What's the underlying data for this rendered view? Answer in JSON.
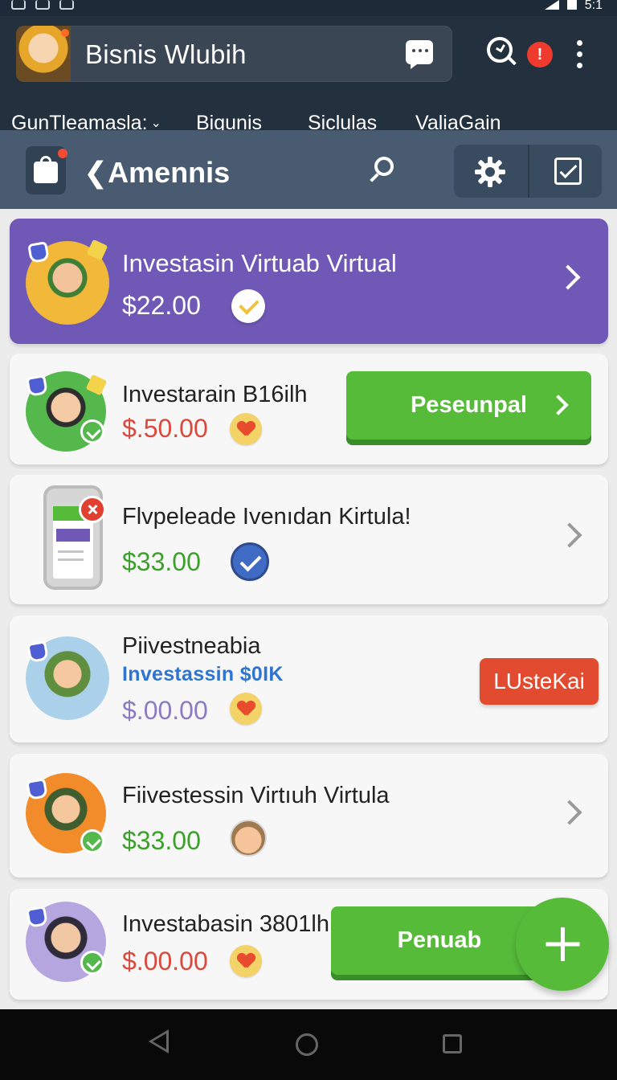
{
  "status_bar": {
    "time_partial": "5:1"
  },
  "header": {
    "title": "Bisnis Wlubih",
    "alert_count": "!",
    "tabs": [
      {
        "label": "GunTleamasla:"
      },
      {
        "label": "Bigunis"
      },
      {
        "label": "Siclulas"
      },
      {
        "label": "ValiaGain"
      }
    ]
  },
  "toolbar": {
    "title": "❮Amennis"
  },
  "cards": [
    {
      "title": "Investasin Virtuab Virtual",
      "amount": "$22.00"
    },
    {
      "title": "Investarain B16ilh",
      "amount": "$.50.00",
      "button": "Peseunpal"
    },
    {
      "title": "Flvpeleade Ivenıdan Kirtula!",
      "amount": "$33.00"
    },
    {
      "title": "Piivestneabia",
      "subtitle": "Investassin $0IK",
      "amount": "$.00.00",
      "button": "LUsteKai"
    },
    {
      "title": "Fiivestessin Virtıuh Virtula",
      "amount": "$33.00"
    },
    {
      "title": "Investabasin 3801lh",
      "amount": "$.00.00",
      "button": "Penuab"
    }
  ],
  "colors": {
    "accent_purple": "#6f58b6",
    "accent_green": "#57bb3a",
    "accent_red": "#e24b2f",
    "header_dark": "#23313f",
    "toolbar_slate": "#485b70"
  },
  "icons": {
    "header": [
      "chat-icon",
      "search-check-icon",
      "more-vert-icon"
    ],
    "toolbar": [
      "shopping-bag-icon",
      "search-icon",
      "settings-icon",
      "edit-icon"
    ],
    "navigation": [
      "back-icon",
      "home-icon",
      "recent-apps-icon"
    ]
  }
}
